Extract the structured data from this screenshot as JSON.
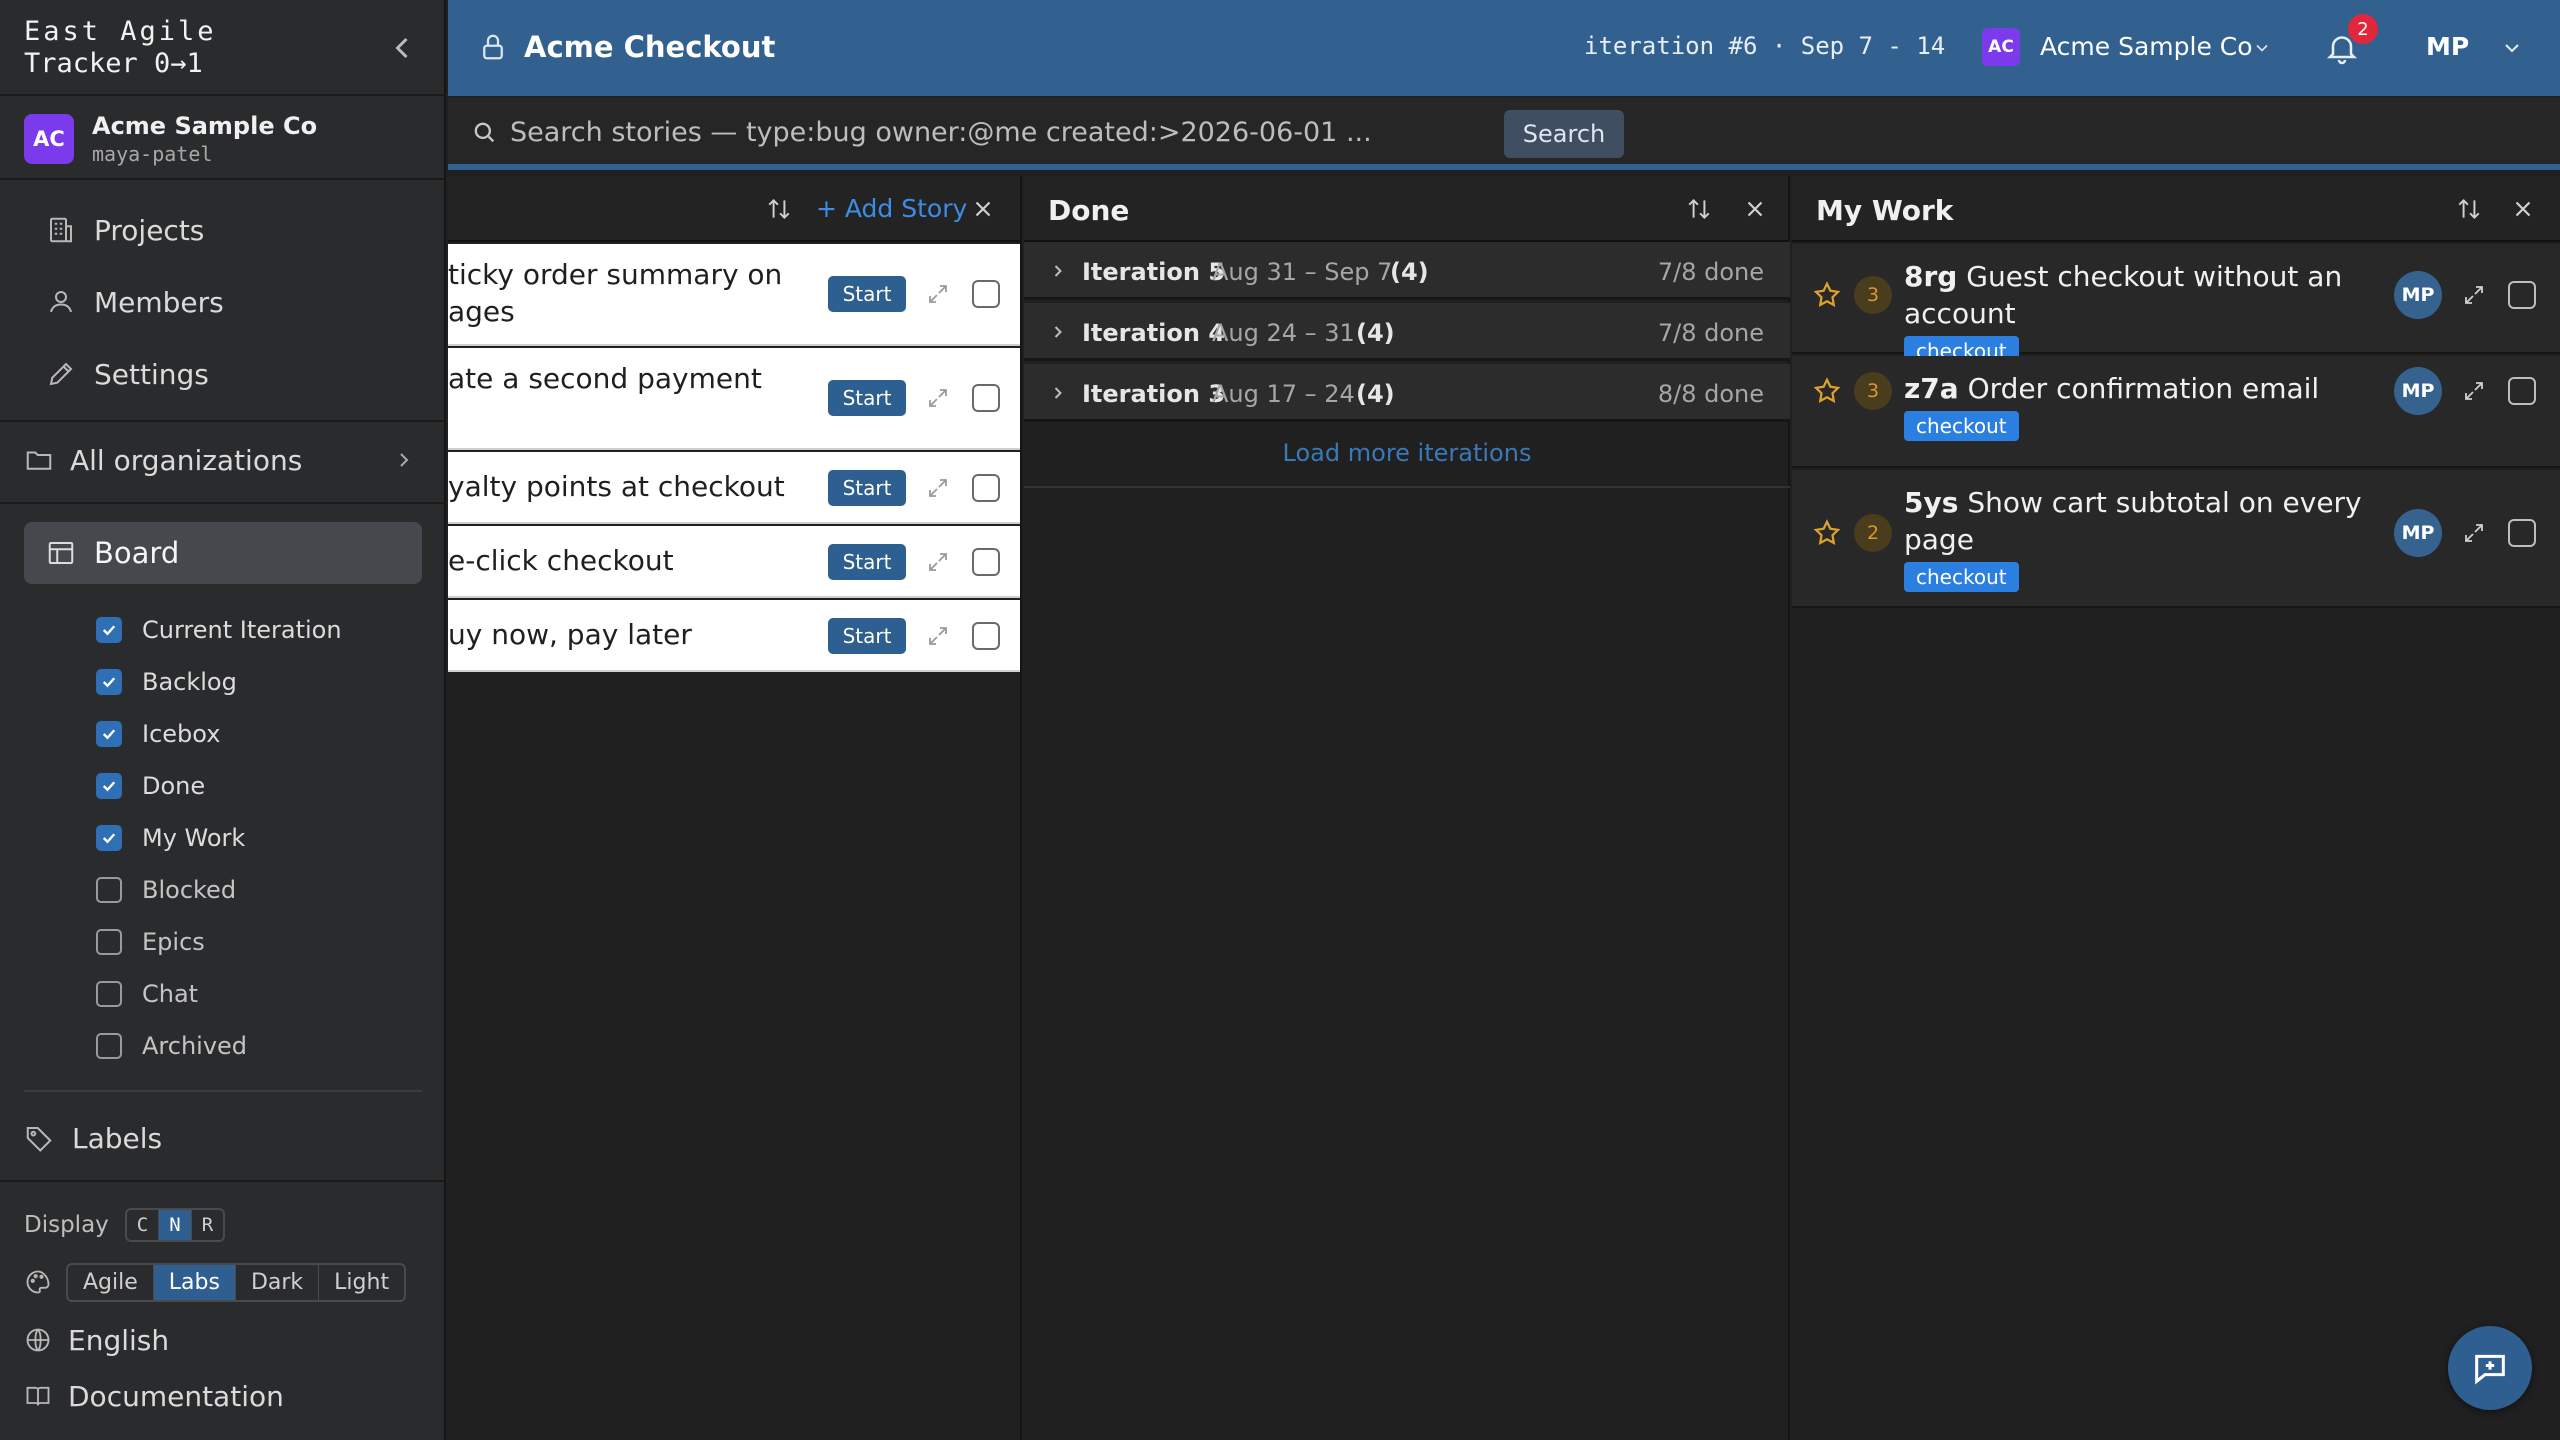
{
  "sidebar": {
    "brand_line1": "East Agile",
    "brand_line2": "Tracker 0→1",
    "org": {
      "badge": "AC",
      "name": "Acme Sample Co",
      "user": "maya-patel"
    },
    "nav": [
      {
        "label": "Projects",
        "icon": "building-icon"
      },
      {
        "label": "Members",
        "icon": "user-icon"
      },
      {
        "label": "Settings",
        "icon": "pencil-icon"
      }
    ],
    "all_orgs_label": "All organizations",
    "board_label": "Board",
    "panels": [
      {
        "label": "Current Iteration",
        "checked": true
      },
      {
        "label": "Backlog",
        "checked": true
      },
      {
        "label": "Icebox",
        "checked": true
      },
      {
        "label": "Done",
        "checked": true
      },
      {
        "label": "My Work",
        "checked": true
      },
      {
        "label": "Blocked",
        "checked": false
      },
      {
        "label": "Epics",
        "checked": false
      },
      {
        "label": "Chat",
        "checked": false
      },
      {
        "label": "Archived",
        "checked": false
      }
    ],
    "labels_label": "Labels",
    "display_label": "Display",
    "display_options": [
      "C",
      "N",
      "R"
    ],
    "display_selected": "N",
    "themes": [
      "Agile",
      "Labs",
      "Dark",
      "Light"
    ],
    "theme_selected": "Labs",
    "language": "English",
    "documentation": "Documentation"
  },
  "header": {
    "project_title": "Acme Checkout",
    "iteration": "iteration #6 · Sep 7 - 14",
    "org_badge": "AC",
    "org_name": "Acme Sample Co",
    "notification_count": "2",
    "user_initials": "MP"
  },
  "search": {
    "placeholder": "Search stories — type:bug owner:@me created:>2026-06-01 ...",
    "button_label": "Search"
  },
  "backlog_panel": {
    "add_story_label": "+ Add Story",
    "stories": [
      {
        "title_lines": [
          "ticky order summary on",
          "ages"
        ],
        "action": "Start"
      },
      {
        "title_lines": [
          "ate a second payment"
        ],
        "action": "Start"
      },
      {
        "title_lines": [
          "yalty points at checkout"
        ],
        "action": "Start"
      },
      {
        "title_lines": [
          "e-click checkout"
        ],
        "action": "Start"
      },
      {
        "title_lines": [
          "uy now, pay later"
        ],
        "action": "Start"
      }
    ]
  },
  "done_panel": {
    "title": "Done",
    "iterations": [
      {
        "name": "Iteration 5",
        "dates": "Aug 31 – Sep 7",
        "count": "(4)",
        "done": "7/8 done"
      },
      {
        "name": "Iteration 4",
        "dates": "Aug 24 – 31",
        "count": "(4)",
        "done": "7/8 done"
      },
      {
        "name": "Iteration 3",
        "dates": "Aug 17 – 24",
        "count": "(4)",
        "done": "8/8 done"
      }
    ],
    "load_more_label": "Load more iterations"
  },
  "mywork_panel": {
    "title": "My Work",
    "stories": [
      {
        "points": "3",
        "id": "8rg",
        "title_lines": [
          "Guest checkout without an",
          "account"
        ],
        "label": "checkout",
        "owner": "MP"
      },
      {
        "points": "3",
        "id": "z7a",
        "title_lines": [
          "Order confirmation email"
        ],
        "label": "checkout",
        "owner": "MP"
      },
      {
        "points": "2",
        "id": "5ys",
        "title_lines": [
          "Show cart subtotal on every",
          "page"
        ],
        "label": "checkout",
        "owner": "MP"
      }
    ]
  },
  "colors": {
    "header_bg": "#33618f",
    "accent": "#2f5f91",
    "label_chip": "#2b7fe0",
    "notification": "#e0283a",
    "org_badge": "#7c3aed"
  }
}
